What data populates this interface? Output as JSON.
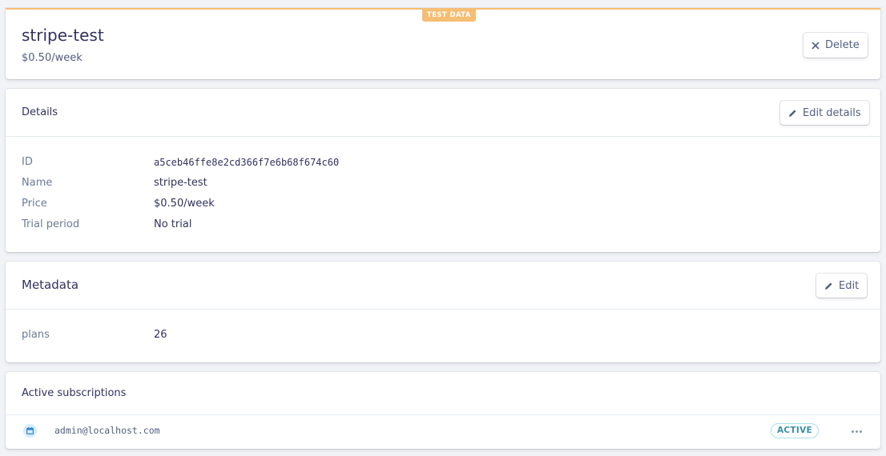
{
  "header": {
    "badge": "TEST DATA",
    "title": "stripe-test",
    "subtitle": "$0.50/week",
    "delete_label": "Delete"
  },
  "details": {
    "title": "Details",
    "edit_label": "Edit details",
    "rows": [
      {
        "label": "ID",
        "value": "a5ceb46ffe8e2cd366f7e6b68f674c60"
      },
      {
        "label": "Name",
        "value": "stripe-test"
      },
      {
        "label": "Price",
        "value": "$0.50/week"
      },
      {
        "label": "Trial period",
        "value": "No trial"
      }
    ]
  },
  "metadata": {
    "title": "Metadata",
    "edit_label": "Edit",
    "rows": [
      {
        "label": "plans",
        "value": "26"
      }
    ]
  },
  "subscriptions": {
    "title": "Active subscriptions",
    "items": [
      {
        "email": "admin@localhost.com",
        "status": "ACTIVE"
      }
    ]
  },
  "colors": {
    "test_accent": "#f5be73",
    "active_text": "#3e8ea3",
    "icon_bg": "#d4ecfb"
  },
  "icons": {
    "delete": "close-icon",
    "edit": "pencil-icon",
    "subscription": "calendar-icon",
    "more": "more-icon"
  }
}
